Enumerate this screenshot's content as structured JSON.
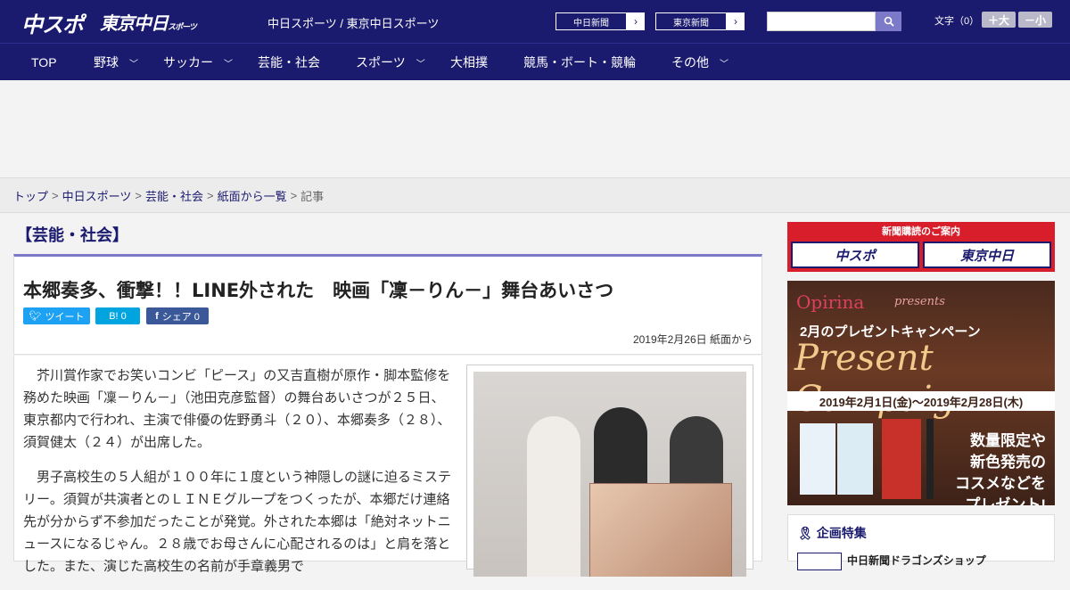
{
  "header": {
    "logo_chusupo": "中スポ",
    "logo_tokyo": "東京中日",
    "logo_tokyo_sub": "スポーツ",
    "site_names": "中日スポーツ / 東京中日スポーツ",
    "paper_buttons": [
      {
        "label": "中日新聞",
        "arrow": "›"
      },
      {
        "label": "東京新聞",
        "arrow": "›"
      }
    ],
    "search": {
      "placeholder": "",
      "icon": "search-icon"
    },
    "font_size_label": "文字（0）",
    "font_up": "＋大",
    "font_down": "－小"
  },
  "nav": {
    "items": [
      {
        "label": "TOP",
        "has_chevron": false
      },
      {
        "label": "野球",
        "has_chevron": true
      },
      {
        "label": "サッカー",
        "has_chevron": true
      },
      {
        "label": "芸能・社会",
        "has_chevron": false
      },
      {
        "label": "スポーツ",
        "has_chevron": true
      },
      {
        "label": "大相撲",
        "has_chevron": false
      },
      {
        "label": "競馬・ボート・競輪",
        "has_chevron": false
      },
      {
        "label": "その他",
        "has_chevron": true
      }
    ],
    "chevron": "﹀"
  },
  "breadcrumb": {
    "items": [
      "トップ",
      "中日スポーツ",
      "芸能・社会",
      "紙面から一覧"
    ],
    "current": "記事",
    "sep": ">"
  },
  "article": {
    "category": "【芸能・社会】",
    "title": "本郷奏多、衝撃！！LINE外された　映画「凜－りん－」舞台あいさつ",
    "share": {
      "tweet": "ツイート",
      "hatena": "B! 0",
      "facebook": "シェア 0"
    },
    "meta": "2019年2月26日 紙面から",
    "paragraphs": [
      "芥川賞作家でお笑いコンビ「ピース」の又吉直樹が原作・脚本監修を務めた映画「凜－りん－」（池田克彦監督）の舞台あいさつが２５日、東京都内で行われ、主演で俳優の佐野勇斗（２０）、本郷奏多（２８）、須賀健太（２４）が出席した。",
      "男子高校生の５人組が１００年に１度という神隠しの謎に迫るミステリー。須賀が共演者とのＬＩＮＥグループをつくったが、本郷だけ連絡先が分からず不参加だったことが発覚。外された本郷は「絶対ネットニュースになるじゃん。２８歳でお母さんに心配されるのは」と肩を落とした。また、演じた高校生の名前が手章義男で"
    ]
  },
  "sidebar": {
    "subscribe_banner": {
      "title": "新聞購読のご案内",
      "left": "中スポ",
      "right": "東京中日"
    },
    "promo": {
      "brand": "Opirina",
      "presents": "presents",
      "campaign": "2月のプレゼントキャンペーン",
      "big": "Present Campaign",
      "period": "2019年2月1日(金)～2019年2月28日(木)",
      "limited_1": "数量限定や",
      "limited_2": "新色発売の",
      "limited_3": "コスメなどを",
      "limited_4": "プレゼント!"
    },
    "feature": {
      "title": "企画特集",
      "item": "中日新聞ドラゴンズショップ"
    }
  },
  "colors": {
    "header_bg": "#1a1a6e",
    "accent": "#7d79c9",
    "banner_red": "#d81e2a"
  }
}
